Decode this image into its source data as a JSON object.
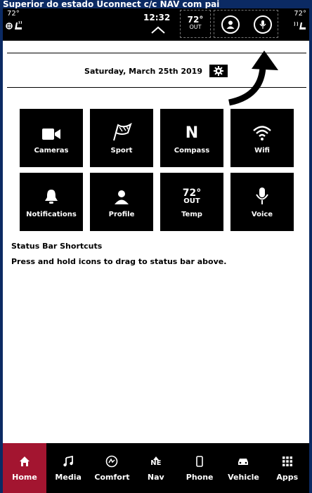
{
  "caption": "Superior do estado Uconnect c/c NAV com pai",
  "status_bar": {
    "left_temp": "72°",
    "clock": "12:32",
    "out_temp": "72°",
    "out_label": "OUT",
    "right_temp": "72°"
  },
  "header": {
    "date": "Saturday, March 25th 2019"
  },
  "tiles": [
    {
      "label": "Cameras",
      "icon": "camera-icon"
    },
    {
      "label": "Sport",
      "icon": "sport-flag-icon"
    },
    {
      "label": "Compass",
      "icon": "compass-icon",
      "value": "N"
    },
    {
      "label": "Wifi",
      "icon": "wifi-icon"
    },
    {
      "label": "Notifications",
      "icon": "bell-icon"
    },
    {
      "label": "Profile",
      "icon": "profile-icon"
    },
    {
      "label": "Temp",
      "icon": "temp-icon",
      "value": "72°",
      "sub": "OUT"
    },
    {
      "label": "Voice",
      "icon": "microphone-icon"
    }
  ],
  "shortcuts": {
    "title": "Status Bar Shortcuts",
    "description": "Press and hold icons to drag to status bar above."
  },
  "bottom_nav": {
    "active": "Home",
    "accent_color": "#a31530",
    "items": [
      {
        "label": "Home",
        "icon": "home-icon"
      },
      {
        "label": "Media",
        "icon": "music-note-icon"
      },
      {
        "label": "Comfort",
        "icon": "comfort-icon"
      },
      {
        "label": "Nav",
        "icon": "nav-compass-icon",
        "glyph": "NE"
      },
      {
        "label": "Phone",
        "icon": "phone-icon"
      },
      {
        "label": "Vehicle",
        "icon": "vehicle-icon"
      },
      {
        "label": "Apps",
        "icon": "apps-grid-icon"
      }
    ]
  }
}
